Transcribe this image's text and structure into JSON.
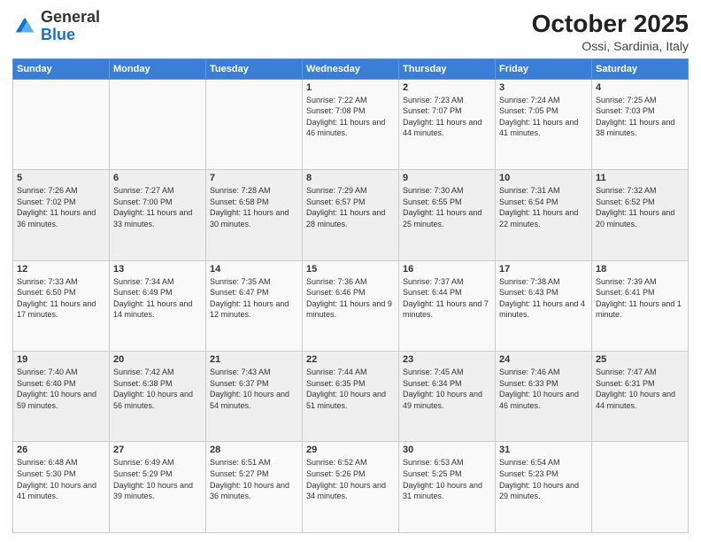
{
  "logo": {
    "line1": "General",
    "line2": "Blue"
  },
  "title": "October 2025",
  "subtitle": "Ossi, Sardinia, Italy",
  "days_of_week": [
    "Sunday",
    "Monday",
    "Tuesday",
    "Wednesday",
    "Thursday",
    "Friday",
    "Saturday"
  ],
  "weeks": [
    [
      {
        "day": "",
        "content": ""
      },
      {
        "day": "",
        "content": ""
      },
      {
        "day": "",
        "content": ""
      },
      {
        "day": "1",
        "content": "Sunrise: 7:22 AM\nSunset: 7:08 PM\nDaylight: 11 hours and 46 minutes."
      },
      {
        "day": "2",
        "content": "Sunrise: 7:23 AM\nSunset: 7:07 PM\nDaylight: 11 hours and 44 minutes."
      },
      {
        "day": "3",
        "content": "Sunrise: 7:24 AM\nSunset: 7:05 PM\nDaylight: 11 hours and 41 minutes."
      },
      {
        "day": "4",
        "content": "Sunrise: 7:25 AM\nSunset: 7:03 PM\nDaylight: 11 hours and 38 minutes."
      }
    ],
    [
      {
        "day": "5",
        "content": "Sunrise: 7:26 AM\nSunset: 7:02 PM\nDaylight: 11 hours and 36 minutes."
      },
      {
        "day": "6",
        "content": "Sunrise: 7:27 AM\nSunset: 7:00 PM\nDaylight: 11 hours and 33 minutes."
      },
      {
        "day": "7",
        "content": "Sunrise: 7:28 AM\nSunset: 6:58 PM\nDaylight: 11 hours and 30 minutes."
      },
      {
        "day": "8",
        "content": "Sunrise: 7:29 AM\nSunset: 6:57 PM\nDaylight: 11 hours and 28 minutes."
      },
      {
        "day": "9",
        "content": "Sunrise: 7:30 AM\nSunset: 6:55 PM\nDaylight: 11 hours and 25 minutes."
      },
      {
        "day": "10",
        "content": "Sunrise: 7:31 AM\nSunset: 6:54 PM\nDaylight: 11 hours and 22 minutes."
      },
      {
        "day": "11",
        "content": "Sunrise: 7:32 AM\nSunset: 6:52 PM\nDaylight: 11 hours and 20 minutes."
      }
    ],
    [
      {
        "day": "12",
        "content": "Sunrise: 7:33 AM\nSunset: 6:50 PM\nDaylight: 11 hours and 17 minutes."
      },
      {
        "day": "13",
        "content": "Sunrise: 7:34 AM\nSunset: 6:49 PM\nDaylight: 11 hours and 14 minutes."
      },
      {
        "day": "14",
        "content": "Sunrise: 7:35 AM\nSunset: 6:47 PM\nDaylight: 11 hours and 12 minutes."
      },
      {
        "day": "15",
        "content": "Sunrise: 7:36 AM\nSunset: 6:46 PM\nDaylight: 11 hours and 9 minutes."
      },
      {
        "day": "16",
        "content": "Sunrise: 7:37 AM\nSunset: 6:44 PM\nDaylight: 11 hours and 7 minutes."
      },
      {
        "day": "17",
        "content": "Sunrise: 7:38 AM\nSunset: 6:43 PM\nDaylight: 11 hours and 4 minutes."
      },
      {
        "day": "18",
        "content": "Sunrise: 7:39 AM\nSunset: 6:41 PM\nDaylight: 11 hours and 1 minute."
      }
    ],
    [
      {
        "day": "19",
        "content": "Sunrise: 7:40 AM\nSunset: 6:40 PM\nDaylight: 10 hours and 59 minutes."
      },
      {
        "day": "20",
        "content": "Sunrise: 7:42 AM\nSunset: 6:38 PM\nDaylight: 10 hours and 56 minutes."
      },
      {
        "day": "21",
        "content": "Sunrise: 7:43 AM\nSunset: 6:37 PM\nDaylight: 10 hours and 54 minutes."
      },
      {
        "day": "22",
        "content": "Sunrise: 7:44 AM\nSunset: 6:35 PM\nDaylight: 10 hours and 51 minutes."
      },
      {
        "day": "23",
        "content": "Sunrise: 7:45 AM\nSunset: 6:34 PM\nDaylight: 10 hours and 49 minutes."
      },
      {
        "day": "24",
        "content": "Sunrise: 7:46 AM\nSunset: 6:33 PM\nDaylight: 10 hours and 46 minutes."
      },
      {
        "day": "25",
        "content": "Sunrise: 7:47 AM\nSunset: 6:31 PM\nDaylight: 10 hours and 44 minutes."
      }
    ],
    [
      {
        "day": "26",
        "content": "Sunrise: 6:48 AM\nSunset: 5:30 PM\nDaylight: 10 hours and 41 minutes."
      },
      {
        "day": "27",
        "content": "Sunrise: 6:49 AM\nSunset: 5:29 PM\nDaylight: 10 hours and 39 minutes."
      },
      {
        "day": "28",
        "content": "Sunrise: 6:51 AM\nSunset: 5:27 PM\nDaylight: 10 hours and 36 minutes."
      },
      {
        "day": "29",
        "content": "Sunrise: 6:52 AM\nSunset: 5:26 PM\nDaylight: 10 hours and 34 minutes."
      },
      {
        "day": "30",
        "content": "Sunrise: 6:53 AM\nSunset: 5:25 PM\nDaylight: 10 hours and 31 minutes."
      },
      {
        "day": "31",
        "content": "Sunrise: 6:54 AM\nSunset: 5:23 PM\nDaylight: 10 hours and 29 minutes."
      },
      {
        "day": "",
        "content": ""
      }
    ]
  ]
}
